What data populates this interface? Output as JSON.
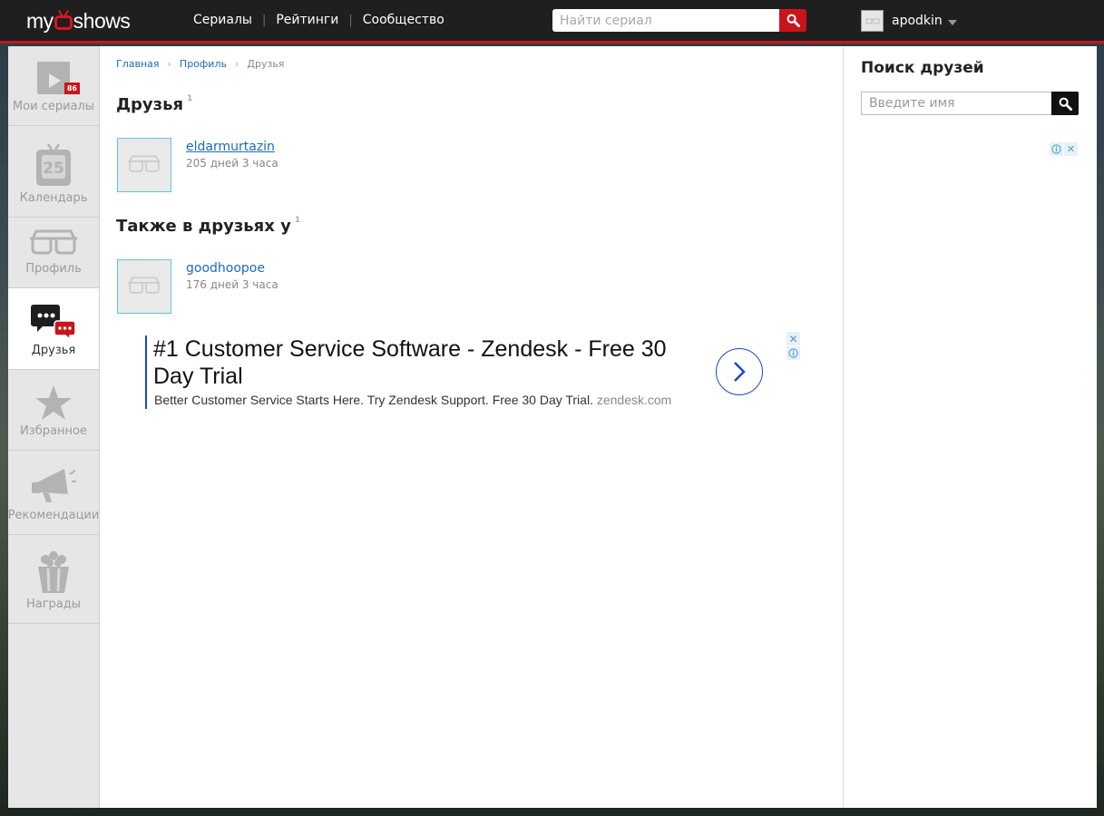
{
  "header": {
    "logo_left": "my",
    "logo_right": "shows",
    "nav": [
      {
        "label": "Сериалы"
      },
      {
        "label": "Рейтинги"
      },
      {
        "label": "Сообщество"
      }
    ],
    "search_placeholder": "Найти сериал",
    "username": "apodkin"
  },
  "sidebar": {
    "items": [
      {
        "label": "Мои сериалы",
        "icon": "clapper-icon",
        "badge": "86"
      },
      {
        "label": "Календарь",
        "icon": "calendar-tv-icon",
        "day": "25"
      },
      {
        "label": "Профиль",
        "icon": "glasses-icon"
      },
      {
        "label": "Друзья",
        "icon": "chat-bubbles-icon",
        "active": true
      },
      {
        "label": "Избранное",
        "icon": "star-icon"
      },
      {
        "label": "Рекомендации",
        "icon": "megaphone-icon"
      },
      {
        "label": "Награды",
        "icon": "popcorn-icon"
      }
    ]
  },
  "breadcrumb": {
    "items": [
      "Главная",
      "Профиль"
    ],
    "current": "Друзья"
  },
  "friends": {
    "title": "Друзья",
    "count": "1",
    "list": [
      {
        "name": "eldarmurtazin",
        "time": "205 дней 3 часа"
      }
    ]
  },
  "also_friends": {
    "title": "Также в друзьях у",
    "count": "1",
    "list": [
      {
        "name": "goodhoopoe",
        "time": "176 дней 3 часа"
      }
    ]
  },
  "ad": {
    "title": "#1 Customer Service Software - Zendesk - Free 30 Day Trial",
    "description": "Better Customer Service Starts Here. Try Zendesk Support. Free 30 Day Trial.",
    "domain": "zendesk.com"
  },
  "right_panel": {
    "title": "Поиск друзей",
    "input_placeholder": "Введите имя"
  },
  "colors": {
    "accent": "#c8151b",
    "link": "#1b6cb8",
    "avatar_border": "#5fc6d6"
  }
}
